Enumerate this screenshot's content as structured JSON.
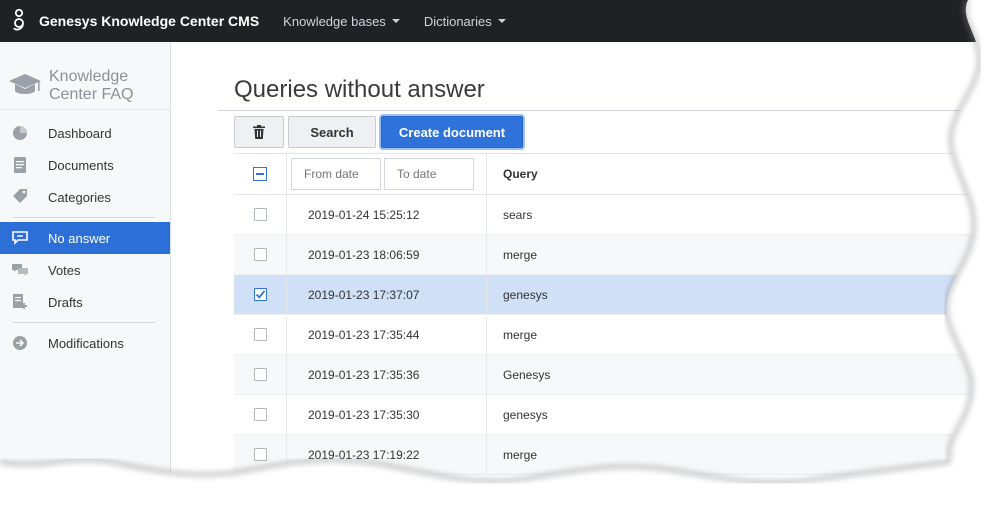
{
  "header": {
    "brand": "Genesys Knowledge Center CMS",
    "nav": [
      {
        "label": "Knowledge bases"
      },
      {
        "label": "Dictionaries"
      }
    ]
  },
  "sidebar": {
    "title_line1": "Knowledge",
    "title_line2": "Center FAQ",
    "items": [
      {
        "label": "Dashboard",
        "icon": "pie-chart-icon"
      },
      {
        "label": "Documents",
        "icon": "document-icon"
      },
      {
        "label": "Categories",
        "icon": "tag-icon"
      },
      {
        "label": "No answer",
        "icon": "chat-unanswered-icon",
        "active": true
      },
      {
        "label": "Votes",
        "icon": "comments-icon"
      },
      {
        "label": "Drafts",
        "icon": "draft-icon"
      },
      {
        "label": "Modifications",
        "icon": "arrow-circle-icon"
      }
    ]
  },
  "main": {
    "title": "Queries without answer",
    "toolbar": {
      "delete_icon": "trash-icon",
      "search_label": "Search",
      "create_label": "Create document"
    },
    "filters": {
      "from_placeholder": "From date",
      "to_placeholder": "To date"
    },
    "table": {
      "query_header": "Query",
      "rows": [
        {
          "date": "2019-01-24 15:25:12",
          "query": "sears",
          "checked": false
        },
        {
          "date": "2019-01-23 18:06:59",
          "query": "merge",
          "checked": false
        },
        {
          "date": "2019-01-23 17:37:07",
          "query": "genesys",
          "checked": true
        },
        {
          "date": "2019-01-23 17:35:44",
          "query": "merge",
          "checked": false
        },
        {
          "date": "2019-01-23 17:35:36",
          "query": "Genesys",
          "checked": false
        },
        {
          "date": "2019-01-23 17:35:30",
          "query": "genesys",
          "checked": false
        },
        {
          "date": "2019-01-23 17:19:22",
          "query": "merge",
          "checked": false
        }
      ]
    }
  },
  "colors": {
    "topbar": "#202124",
    "accent": "#2f73da",
    "selected_row": "#cfe0f7"
  }
}
